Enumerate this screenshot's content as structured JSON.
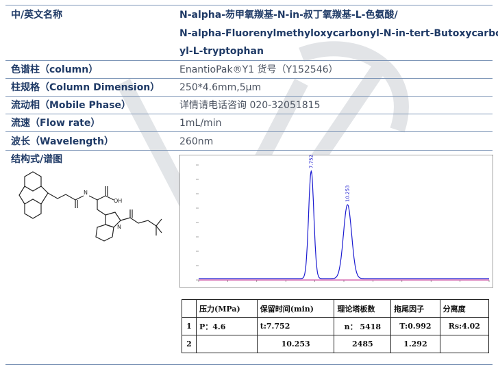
{
  "rows": {
    "name": {
      "label": "中/英文名称",
      "value_cn": "N-alpha-芴甲氧羰基-N-in-叔丁氧羰基-L-色氨酸/",
      "value_en1": "N-alpha-Fluorenylmethyloxycarbonyl-N-in-tert-Butoxycarbon",
      "value_en2": "yl-L-tryptophan"
    },
    "column": {
      "label": "色谱柱（column）",
      "value": "EnantioPak®Y1    货号（Y152546）"
    },
    "dimension": {
      "label": "柱规格（Column Dimension）",
      "value": "250*4.6mm,5μm"
    },
    "mobile_phase": {
      "label": "流动相（Mobile Phase）",
      "value": "详情请电话咨询 020-32051815"
    },
    "flow_rate": {
      "label": "流速（Flow rate）",
      "value": "1mL/min"
    },
    "wavelength": {
      "label": "波长（Wavelength）",
      "value": "260nm"
    },
    "structure": {
      "label": "结构式/谱图"
    }
  },
  "structure_labels": {
    "oh": "OH",
    "o": "O"
  },
  "chart_data": {
    "type": "line",
    "x_unit": "min",
    "peaks": [
      {
        "retention_time": 7.752,
        "label": "7.752"
      },
      {
        "retention_time": 10.253,
        "label": "10.253"
      }
    ]
  },
  "results_table": {
    "headers": [
      "",
      "压力(MPa)",
      "保留时间(min)",
      "理论塔板数",
      "拖尾因子",
      "分离度"
    ],
    "rows": [
      [
        "1",
        "P：4.6",
        "t:7.752",
        "n： 5418",
        "T:0.992",
        "Rs:4.02"
      ],
      [
        "2",
        "",
        "10.253",
        "2485",
        "1.292",
        ""
      ]
    ]
  },
  "colors": {
    "label": "#1f3a66",
    "line": "#7a93b5",
    "trace": "#1a1ad0",
    "baseline": "#c0208a"
  }
}
